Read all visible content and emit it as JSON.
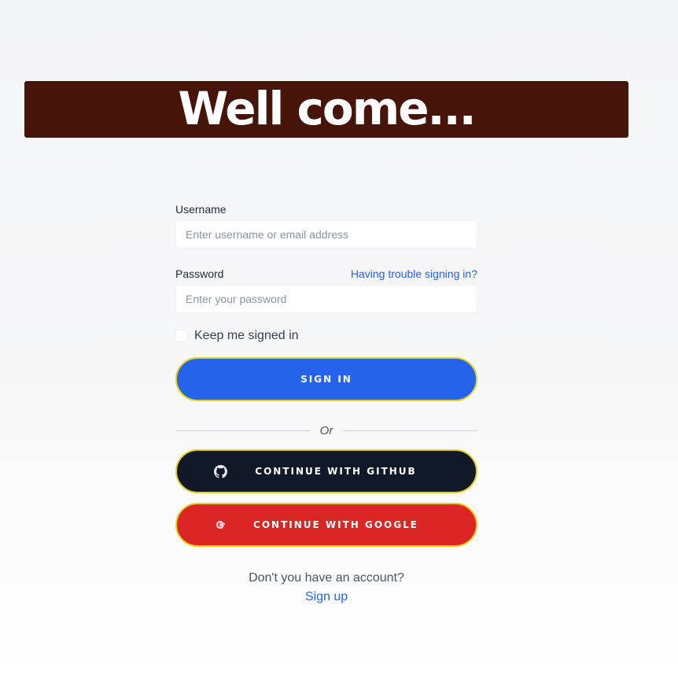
{
  "banner": {
    "title": "Well come..."
  },
  "form": {
    "username": {
      "label": "Username",
      "placeholder": "Enter username or email address"
    },
    "password": {
      "label": "Password",
      "placeholder": "Enter your password",
      "trouble_link": "Having trouble signing in?"
    },
    "remember": {
      "label": "Keep me signed in"
    },
    "sign_in_label": "SIGN IN",
    "divider_text": "Or",
    "github_label": "CONTINUE WITH GITHUB",
    "google_label": "CONTINUE WITH GOOGLE",
    "footer": {
      "prompt": "Don't you have an account?",
      "signup_link": "Sign up"
    }
  },
  "icons": {
    "github": "github-icon",
    "google": "google-icon"
  },
  "colors": {
    "banner_bg": "#461409",
    "primary": "#2563eb",
    "github_bg": "#111827",
    "google_bg": "#dc2626",
    "button_border": "#e3d21a"
  }
}
